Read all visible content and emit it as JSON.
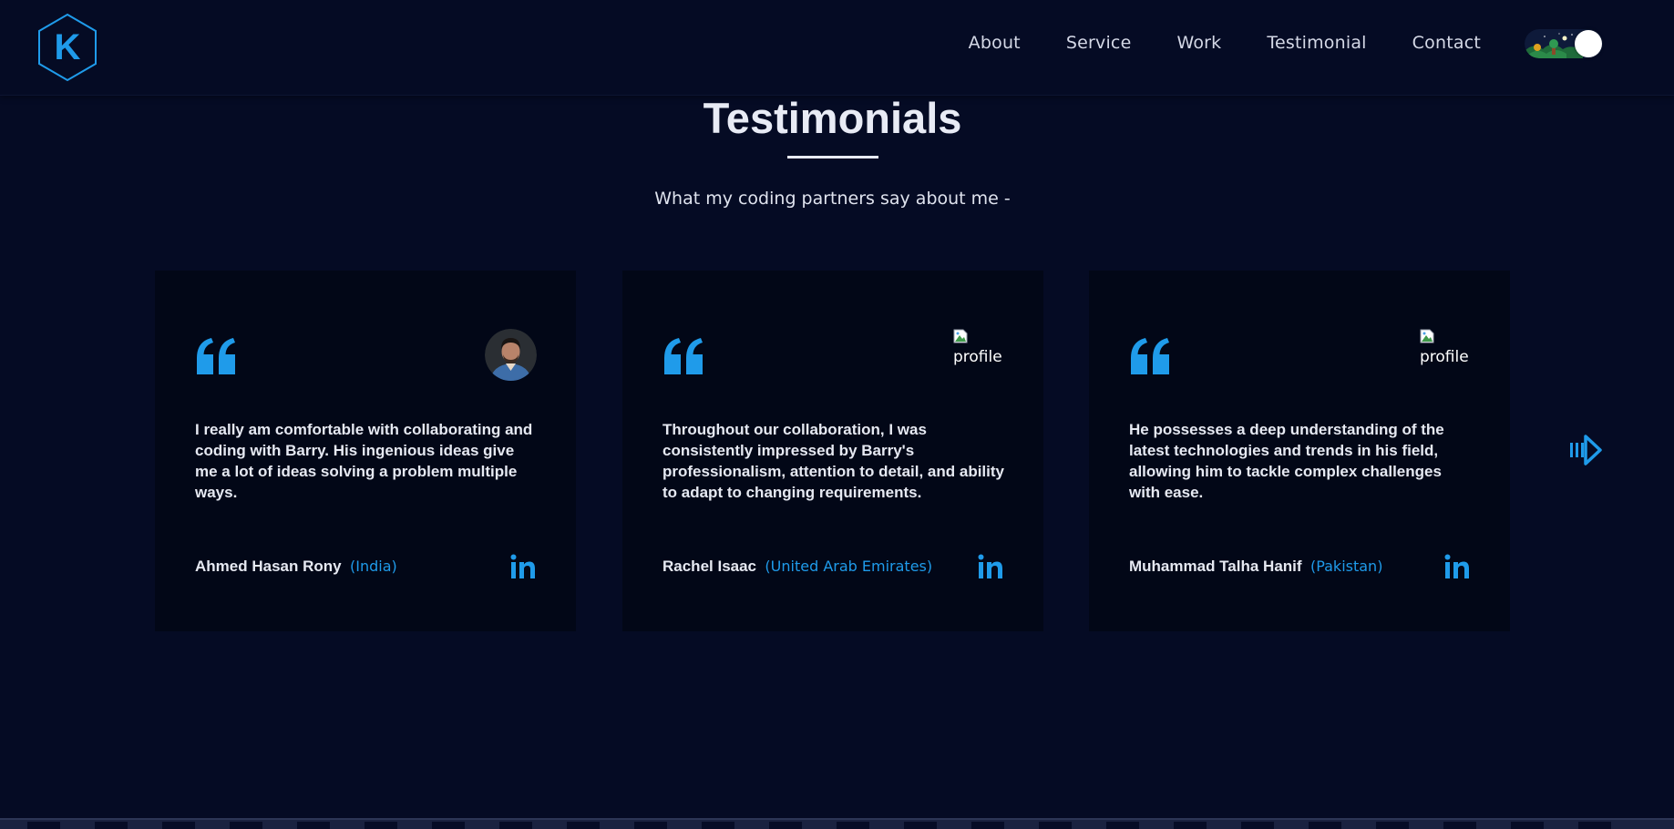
{
  "nav": {
    "logo_letter": "K",
    "links": [
      "About",
      "Service",
      "Work",
      "Testimonial",
      "Contact"
    ]
  },
  "section": {
    "title": "Testimonials",
    "subtitle": "What my coding partners say about me -"
  },
  "testimonials": [
    {
      "text": "I really am comfortable with collaborating and coding with Barry. His ingenious ideas give me a lot of ideas solving a problem multiple ways.",
      "name": "Ahmed Hasan Rony",
      "country": "(India)"
    },
    {
      "text": "Throughout our collaboration, I was consistently impressed by Barry's professionalism, attention to detail, and ability to adapt to changing requirements.",
      "name": "Rachel Isaac",
      "country": "(United Arab Emirates)",
      "image_alt": "profile"
    },
    {
      "text": "He possesses a deep understanding of the latest technologies and trends in his field, allowing him to tackle complex challenges with ease.",
      "name": "Muhammad Talha Hanif",
      "country": "(Pakistan)",
      "image_alt": "profile"
    }
  ],
  "colors": {
    "background": "#050b24",
    "card": "#020717",
    "accent": "#1f9bea",
    "text": "#e6e9f2"
  },
  "icons": {
    "quote": "quote-icon",
    "linkedin": "linkedin-icon",
    "next": "next-arrow-icon",
    "theme": "theme-toggle-icon"
  }
}
